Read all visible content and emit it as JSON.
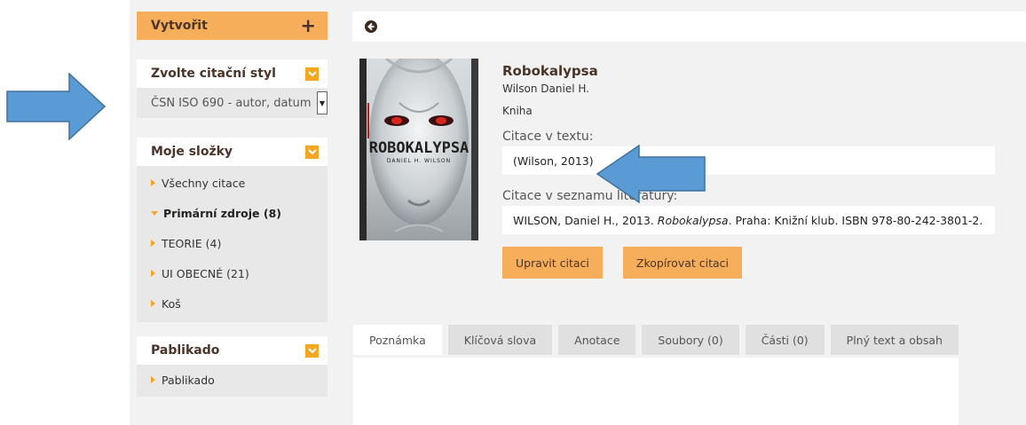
{
  "sidebar": {
    "create_label": "Vytvořit",
    "create_icon": "+",
    "citation_style": {
      "title": "Zvolte citační styl",
      "value": "ČSN ISO 690 - autor, datum"
    },
    "folders": {
      "title": "Moje složky",
      "items": [
        {
          "label": "Všechny citace"
        },
        {
          "label": "Primární zdroje (8)"
        },
        {
          "label": "TEORIE (4)"
        },
        {
          "label": "UI OBECNÉ (21)"
        },
        {
          "label": "Koš"
        }
      ]
    },
    "pablikado": {
      "title": "Pablikado",
      "items": [
        {
          "label": "Pablikado"
        }
      ]
    }
  },
  "book": {
    "title": "Robokalypsa",
    "author": "Wilson Daniel H.",
    "type": "Kniha",
    "cover_title": "ROBOKALYPSA",
    "cover_author": "DANIEL H. WILSON"
  },
  "citation": {
    "in_text_label": "Citace v textu:",
    "in_text_value": "(Wilson, 2013)",
    "bib_label": "Citace v seznamu literatury:",
    "bib_prefix": "WILSON, Daniel H., 2013. ",
    "bib_title": "Robokalypsa",
    "bib_suffix": ". Praha: Knižní klub. ISBN 978-80-242-3801-2."
  },
  "actions": {
    "edit_label": "Upravit citaci",
    "copy_label": "Zkopírovat citaci"
  },
  "tabs": [
    {
      "label": "Poznámka"
    },
    {
      "label": "Klíčová slova"
    },
    {
      "label": "Anotace"
    },
    {
      "label": "Soubory (0)"
    },
    {
      "label": "Části (0)"
    },
    {
      "label": "Plný text a obsah"
    }
  ],
  "colors": {
    "accent": "#f6ae5b",
    "brown_text": "#4a3428",
    "arrow_blue": "#5b9bd5"
  }
}
